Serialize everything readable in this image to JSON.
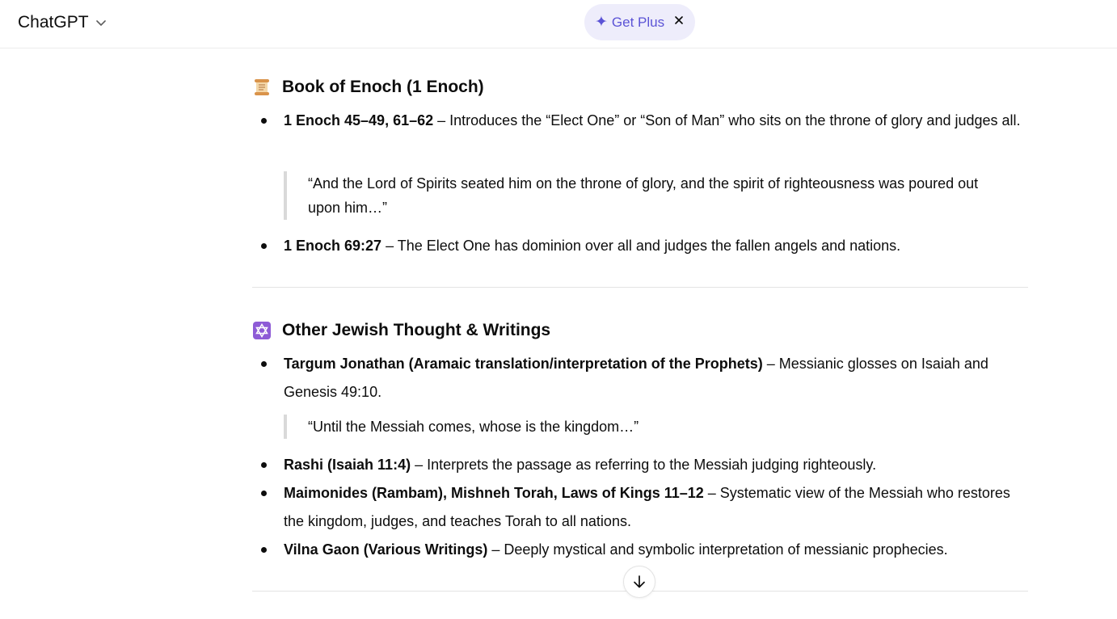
{
  "header": {
    "model_name": "ChatGPT",
    "get_plus": {
      "sparkle": "✦",
      "label": "Get Plus"
    }
  },
  "sections": [
    {
      "emoji": "scroll-emoji",
      "title": "Book of Enoch (1 Enoch)",
      "items": [
        {
          "ref": "1 Enoch 45–49, 61–62",
          "text": " – Introduces the “Elect One” or “Son of Man” who sits on the throne of glory and judges all.",
          "quote": "“And the Lord of Spirits seated him on the throne of glory, and the spirit of righteousness was poured out upon him…”"
        },
        {
          "ref": "1 Enoch 69:27",
          "text": " – The Elect One has dominion over all and judges the fallen angels and nations."
        }
      ]
    },
    {
      "emoji": "star-of-david-emoji",
      "title": "Other Jewish Thought & Writings",
      "items": [
        {
          "ref": "Targum Jonathan (Aramaic translation/interpretation of the Prophets)",
          "text": " – Messianic glosses on Isaiah and Genesis 49:10.",
          "quote": "“Until the Messiah comes, whose is the kingdom…”"
        },
        {
          "ref": "Rashi (Isaiah 11:4)",
          "text": " – Interprets the passage as referring to the Messiah judging righteously."
        },
        {
          "ref": "Maimonides (Rambam), Mishneh Torah, Laws of Kings 11–12",
          "text": " – Systematic view of the Messiah who restores the kingdom, judges, and teaches Torah to all nations."
        },
        {
          "ref": "Vilna Gaon (Various Writings)",
          "text": " – Deeply mystical and symbolic interpretation of messianic prophecies."
        }
      ]
    }
  ],
  "colors": {
    "accent": "#5b53d6",
    "get_plus_bg": "#eeedfb",
    "text": "#0d0d0d",
    "divider": "#e3e3e3",
    "quote_bar": "#d9d9d9",
    "star_emoji_bg": "#8e5bd6"
  },
  "icons": [
    "chevron-down-icon",
    "sparkle-icon",
    "close-icon",
    "arrow-down-icon",
    "scroll-emoji",
    "star-of-david-emoji"
  ]
}
